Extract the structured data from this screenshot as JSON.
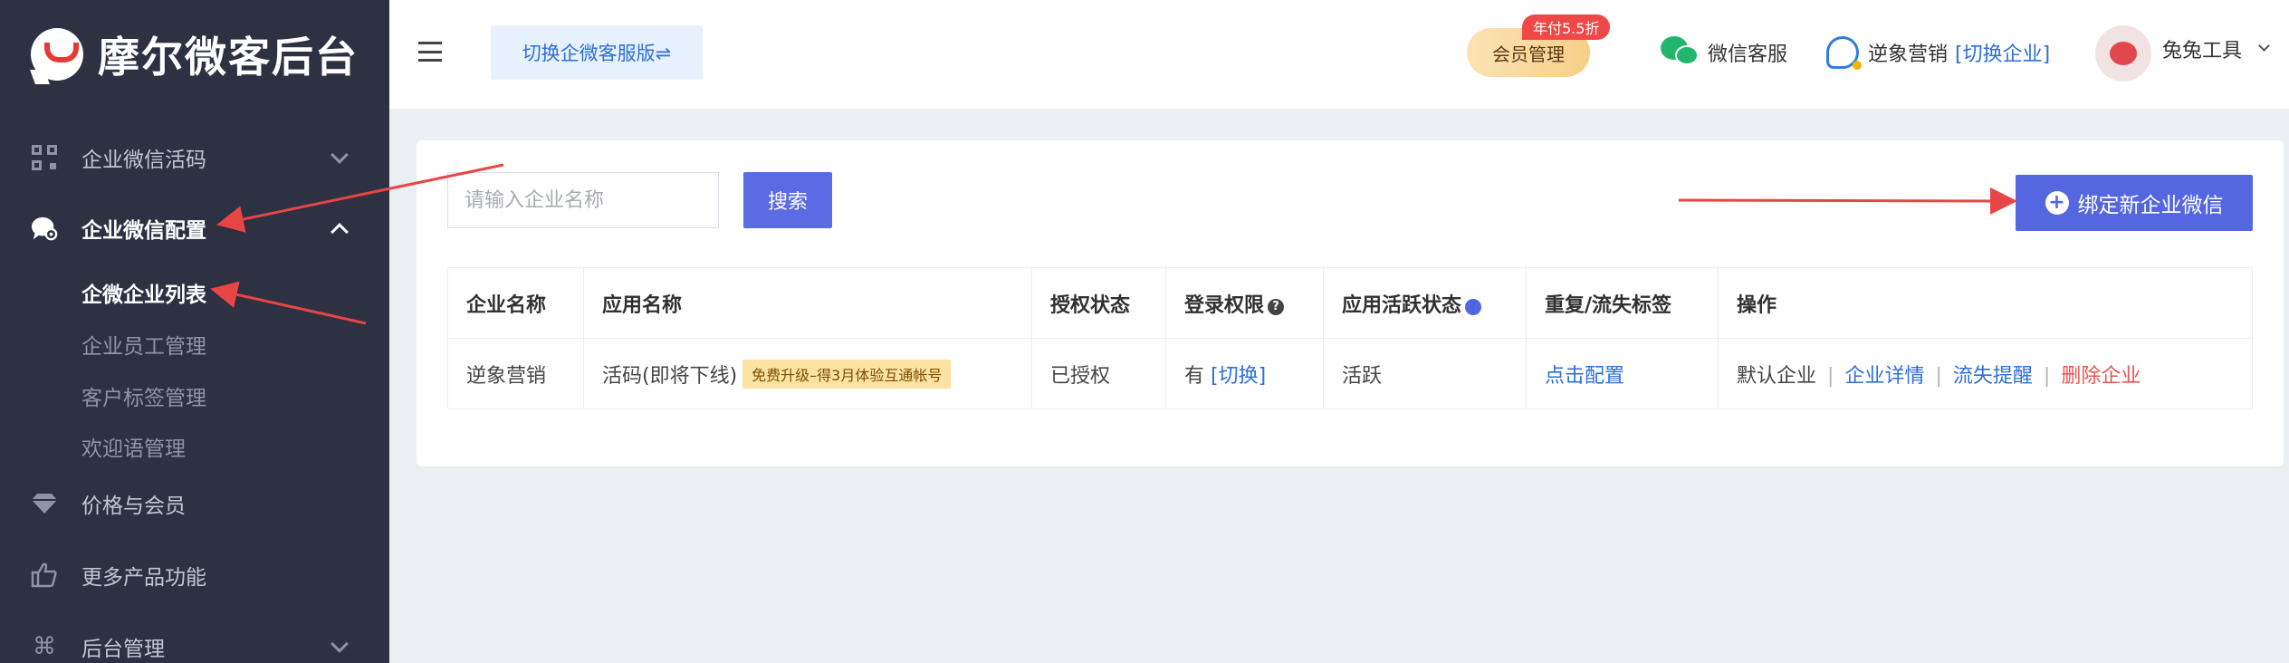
{
  "brand": {
    "title": "摩尔微客后台"
  },
  "sidebar": {
    "items": [
      {
        "label": "企业微信活码",
        "icon": "qr-code-icon"
      },
      {
        "label": "企业微信配置",
        "icon": "chat-settings-icon"
      },
      {
        "label": "价格与会员",
        "icon": "diamond-icon"
      },
      {
        "label": "更多产品功能",
        "icon": "thumbs-up-icon"
      },
      {
        "label": "后台管理",
        "icon": "command-icon"
      }
    ],
    "subitems": [
      {
        "label": "企微企业列表"
      },
      {
        "label": "企业员工管理"
      },
      {
        "label": "客户标签管理"
      },
      {
        "label": "欢迎语管理"
      }
    ]
  },
  "header": {
    "switch_label": "切换企微客服版⇌",
    "member_label": "会员管理",
    "member_badge": "年付5.5折",
    "wechat_service": "微信客服",
    "company_name": "逆象营销",
    "company_switch": "[切换企业]",
    "user_name": "兔兔工具"
  },
  "toolbar": {
    "search_placeholder": "请输入企业名称",
    "search_label": "搜索",
    "bind_label": "绑定新企业微信"
  },
  "table": {
    "headers": {
      "company": "企业名称",
      "app": "应用名称",
      "auth": "授权状态",
      "login": "登录权限",
      "active": "应用活跃状态",
      "tags": "重复/流失标签",
      "ops": "操作"
    },
    "rows": [
      {
        "company": "逆象营销",
        "app": "活码(即将下线)",
        "app_tag": "免费升级–得3月体验互通帐号",
        "auth": "已授权",
        "login": "有",
        "login_switch": "[切换]",
        "active": "活跃",
        "tags": "点击配置",
        "op_default": "默认企业",
        "op_detail": "企业详情",
        "op_alert": "流失提醒",
        "op_delete": "删除企业"
      }
    ]
  },
  "colors": {
    "sidebar_bg": "#2d3142",
    "primary": "#5567e0",
    "success": "#1fb36b",
    "link": "#2f6fd6",
    "danger": "#e85454",
    "annotation_arrow": "#e84545"
  }
}
